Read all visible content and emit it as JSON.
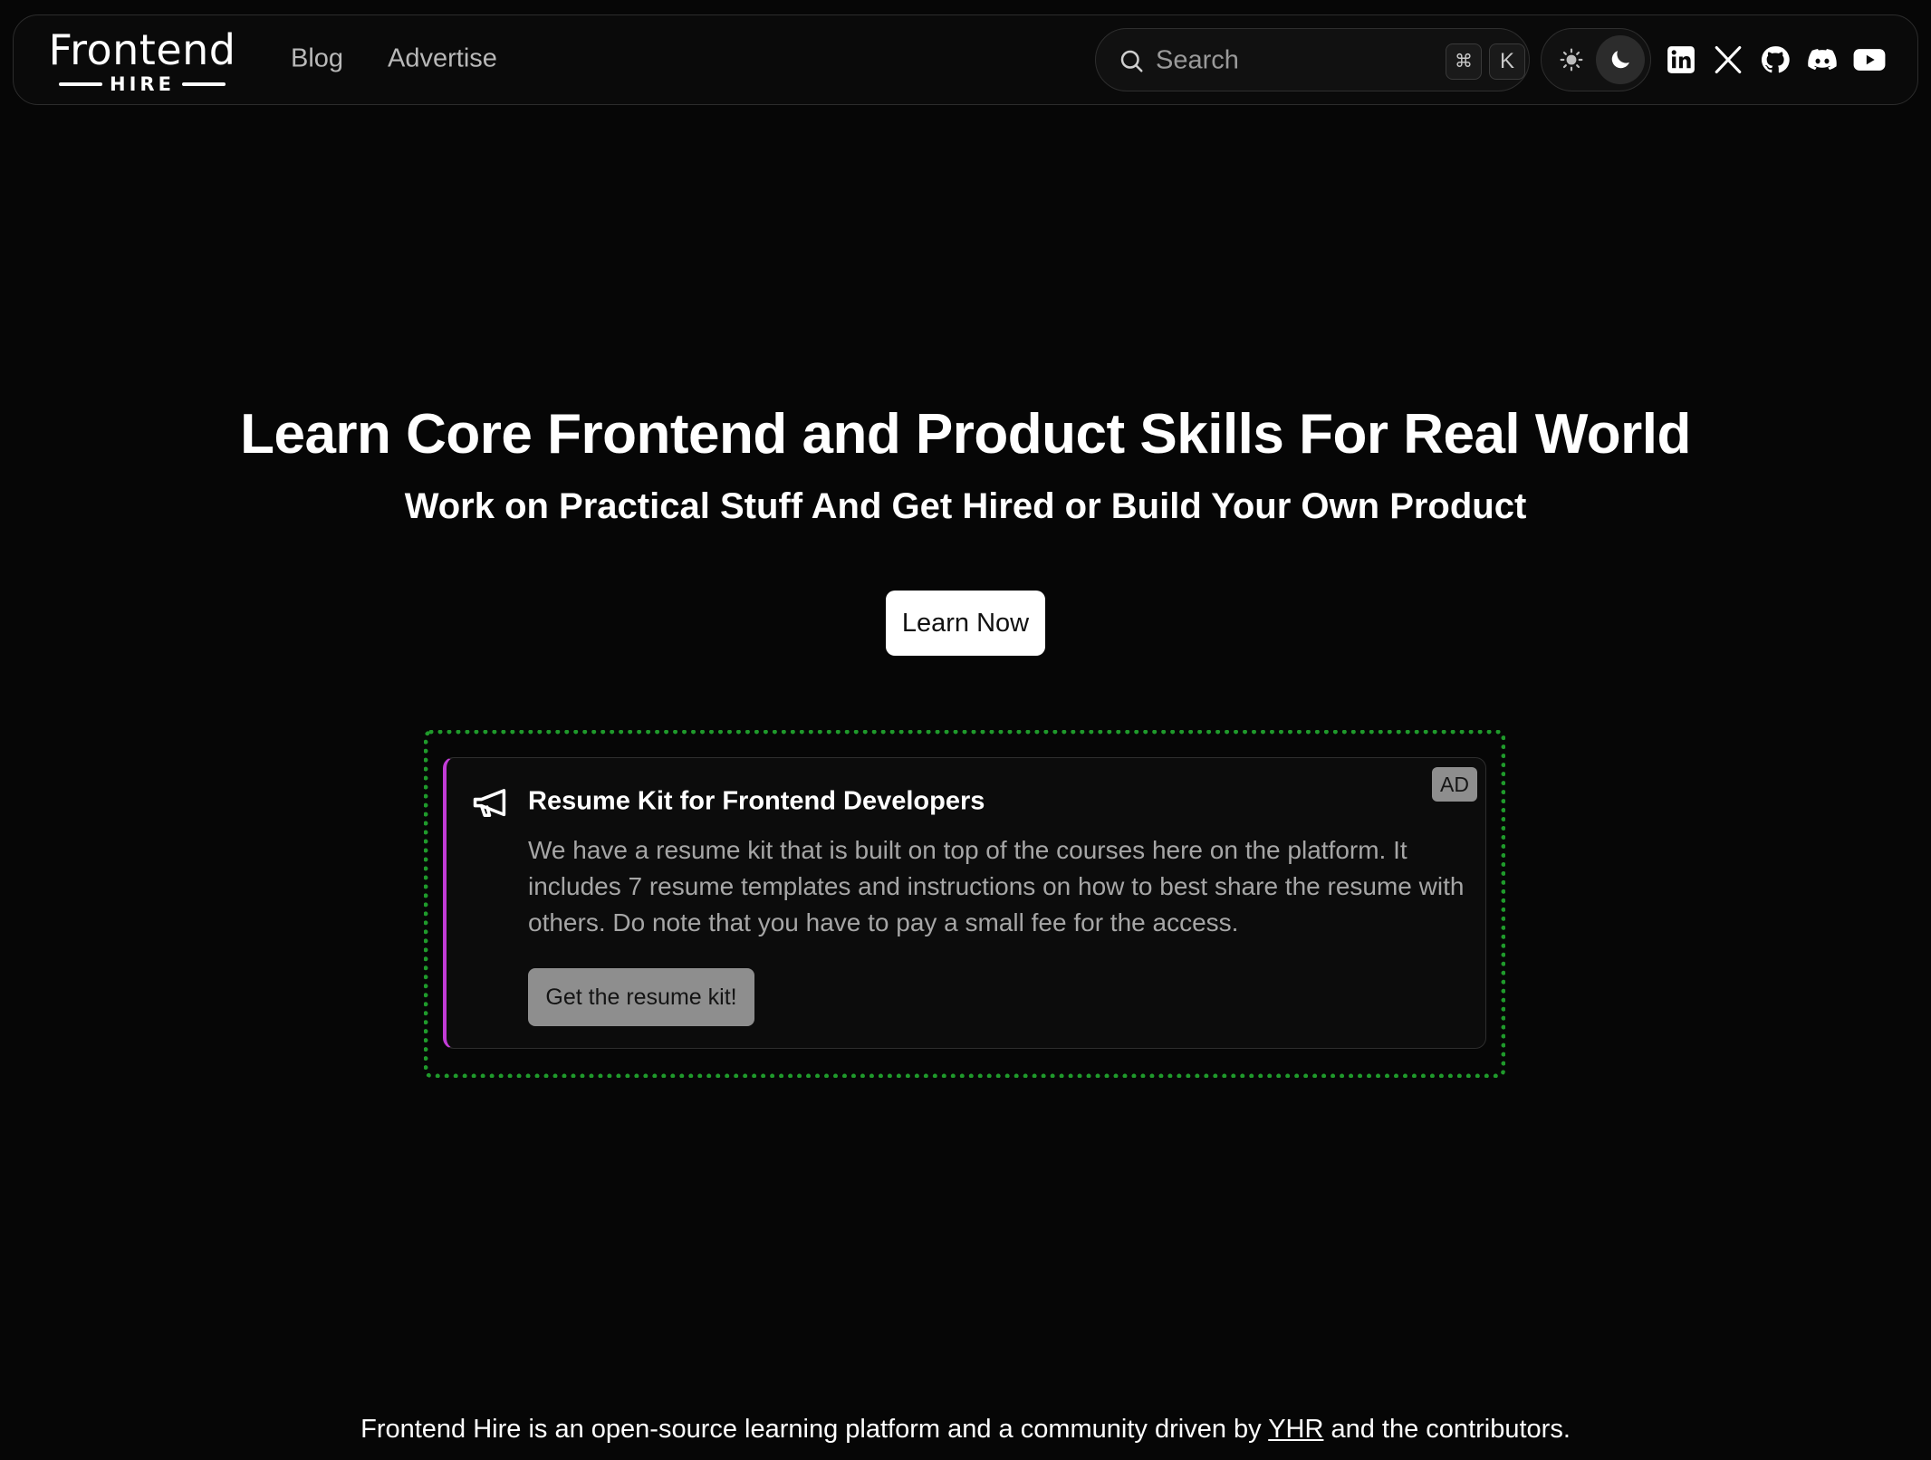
{
  "navbar": {
    "logo": {
      "word": "Frontend",
      "sub": "HIRE"
    },
    "links": [
      {
        "label": "Blog"
      },
      {
        "label": "Advertise"
      }
    ],
    "search": {
      "placeholder": "Search",
      "shortcut_modifier": "⌘",
      "shortcut_key": "K"
    },
    "theme": {
      "light_icon": "sun-icon",
      "dark_icon": "moon-icon",
      "active": "dark"
    },
    "socials": [
      "linkedin-icon",
      "x-icon",
      "github-icon",
      "discord-icon",
      "youtube-icon"
    ]
  },
  "hero": {
    "title": "Learn Core Frontend and Product Skills For Real World",
    "subtitle": "Work on Practical Stuff And Get Hired or Build Your Own Product",
    "cta": "Learn Now"
  },
  "ad": {
    "icon": "megaphone-icon",
    "title": "Resume Kit for Frontend Developers",
    "badge": "AD",
    "body": "We have a resume kit that is built on top of the courses here on the platform. It includes 7 resume templates and instructions on how to best share the resume with others. Do note that you have to pay a small fee for the access.",
    "cta": "Get the resume kit!",
    "accent_color": "#c23cd6",
    "outline_color": "#1f9a2b"
  },
  "footer": {
    "before": "Frontend Hire is an open-source learning platform and a community driven by ",
    "link": "YHR",
    "after": " and the contributors."
  },
  "colors": {
    "background": "#060606",
    "text": "#ffffff",
    "muted": "#a6a6a6"
  }
}
